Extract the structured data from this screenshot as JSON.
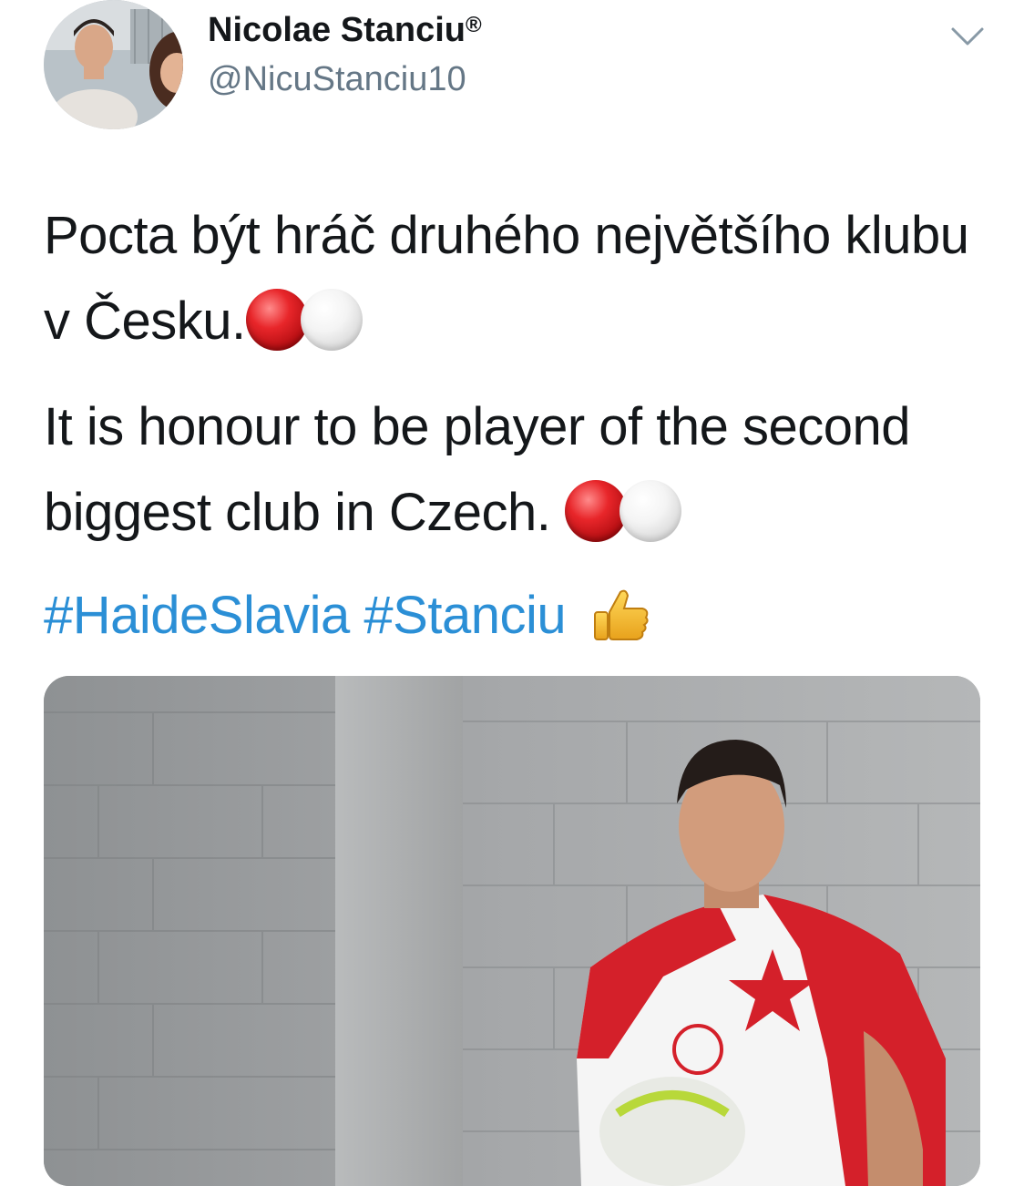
{
  "tweet": {
    "author": {
      "display_name": "Nicolae Stanciu",
      "verified_mark": "®",
      "handle": "@NicuStanciu10",
      "avatar_icon": "profile-photo"
    },
    "menu_icon": "chevron-down-icon",
    "text_cz": "Pocta být hráč druhého největšího klubu v Česku.",
    "text_en": "It is honour to be player of the second biggest club in Czech.",
    "emoji_red": "red-circle",
    "emoji_white": "white-circle",
    "hashtags": [
      "#HaideSlavia",
      "#Stanciu"
    ],
    "thumbs_emoji": "thumbs-up",
    "media": {
      "type": "photo",
      "description_icon": "player-photo"
    }
  },
  "colors": {
    "text": "#14171a",
    "secondary": "#657786",
    "link": "#2b8fd6",
    "slavia_red": "#d4202a"
  }
}
